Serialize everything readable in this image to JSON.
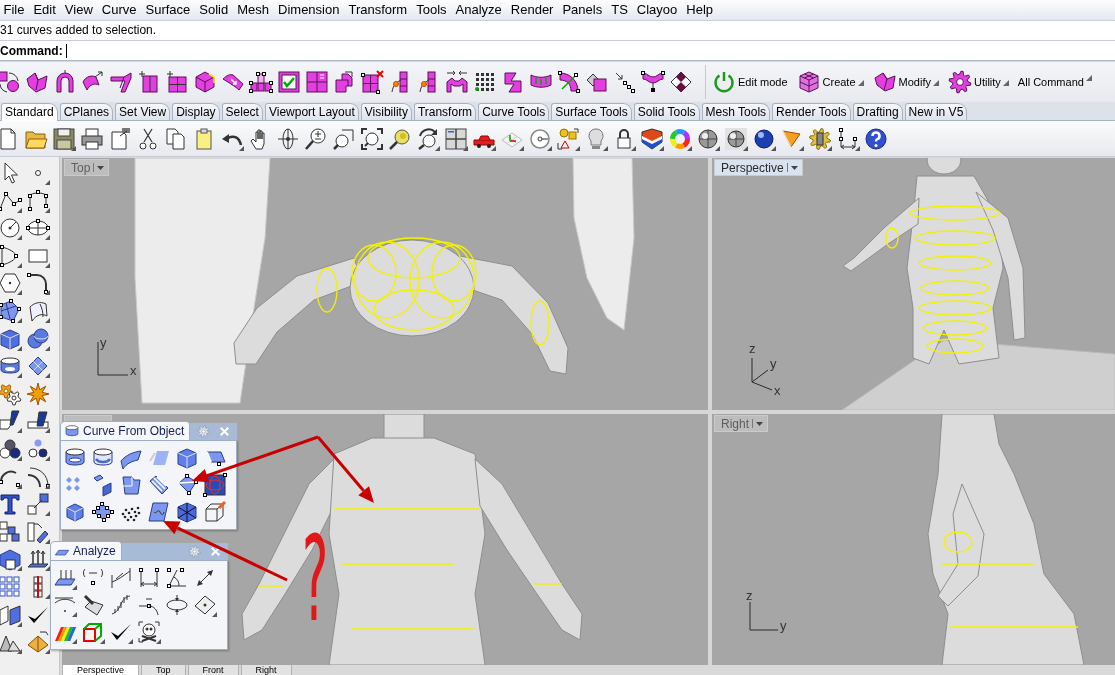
{
  "menu_bar": {
    "items": [
      "File",
      "Edit",
      "View",
      "Curve",
      "Surface",
      "Solid",
      "Mesh",
      "Dimension",
      "Transform",
      "Tools",
      "Analyze",
      "Render",
      "Panels",
      "TS",
      "Clayoo",
      "Help"
    ]
  },
  "command_line": {
    "history": "31 curves added to selection.",
    "prompt": "Command:"
  },
  "main_toolbar": {
    "buttons": [
      {
        "label": "Edit mode",
        "flyout": false
      },
      {
        "label": "Create",
        "flyout": true
      },
      {
        "label": "Modify",
        "flyout": true
      },
      {
        "label": "Utility",
        "flyout": true
      },
      {
        "label": "All Command",
        "flyout": true
      }
    ]
  },
  "toolbar_tabs": [
    {
      "label": "Standard",
      "selected": true
    },
    {
      "label": "CPlanes",
      "selected": false
    },
    {
      "label": "Set View",
      "selected": false
    },
    {
      "label": "Display",
      "selected": false
    },
    {
      "label": "Select",
      "selected": false
    },
    {
      "label": "Viewport Layout",
      "selected": false
    },
    {
      "label": "Visibility",
      "selected": false
    },
    {
      "label": "Transform",
      "selected": false
    },
    {
      "label": "Curve Tools",
      "selected": false
    },
    {
      "label": "Surface Tools",
      "selected": false
    },
    {
      "label": "Solid Tools",
      "selected": false
    },
    {
      "label": "Mesh Tools",
      "selected": false
    },
    {
      "label": "Render Tools",
      "selected": false
    },
    {
      "label": "Drafting",
      "selected": false
    },
    {
      "label": "New in V5",
      "selected": false
    }
  ],
  "viewports": [
    {
      "title": "Top",
      "active": false,
      "axes": [
        "y",
        "x"
      ]
    },
    {
      "title": "Perspective",
      "active": true,
      "axes": [
        "z",
        "y",
        "x"
      ]
    },
    {
      "active": false
    },
    {
      "title": "Right",
      "active": false,
      "axes": [
        "z",
        "y"
      ]
    }
  ],
  "floating_panels": [
    {
      "title": "Curve From Object"
    },
    {
      "title": "Analyze"
    }
  ],
  "annotation": {
    "text": "?"
  },
  "viewport_tabs": [
    {
      "label": "Perspective",
      "selected": true
    },
    {
      "label": "Top",
      "selected": false
    },
    {
      "label": "Front",
      "selected": false
    },
    {
      "label": "Right",
      "selected": false
    }
  ]
}
